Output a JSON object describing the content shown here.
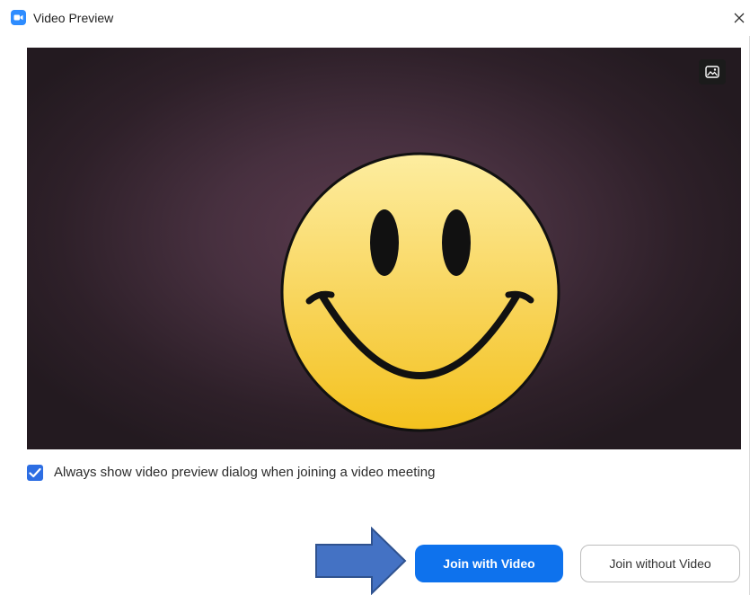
{
  "window": {
    "title": "Video Preview",
    "close_glyph": "×"
  },
  "preview": {
    "background_icon": "image-icon",
    "content": "smiley-face"
  },
  "options": {
    "always_show_preview": {
      "label": "Always show video preview dialog when joining a video meeting",
      "checked": true
    }
  },
  "actions": {
    "join_with_video": "Join with Video",
    "join_without_video": "Join without Video"
  },
  "annotation": {
    "arrow_icon": "arrow-right-icon"
  },
  "colors": {
    "accent": "#0e72ed",
    "checkbox": "#2d6ee3",
    "zoom_icon": "#2d8cff",
    "arrow_fill": "#4472c4",
    "arrow_stroke": "#2f528f",
    "smiley_fill_top": "#fde78f",
    "smiley_fill_bottom": "#f4c21e"
  }
}
